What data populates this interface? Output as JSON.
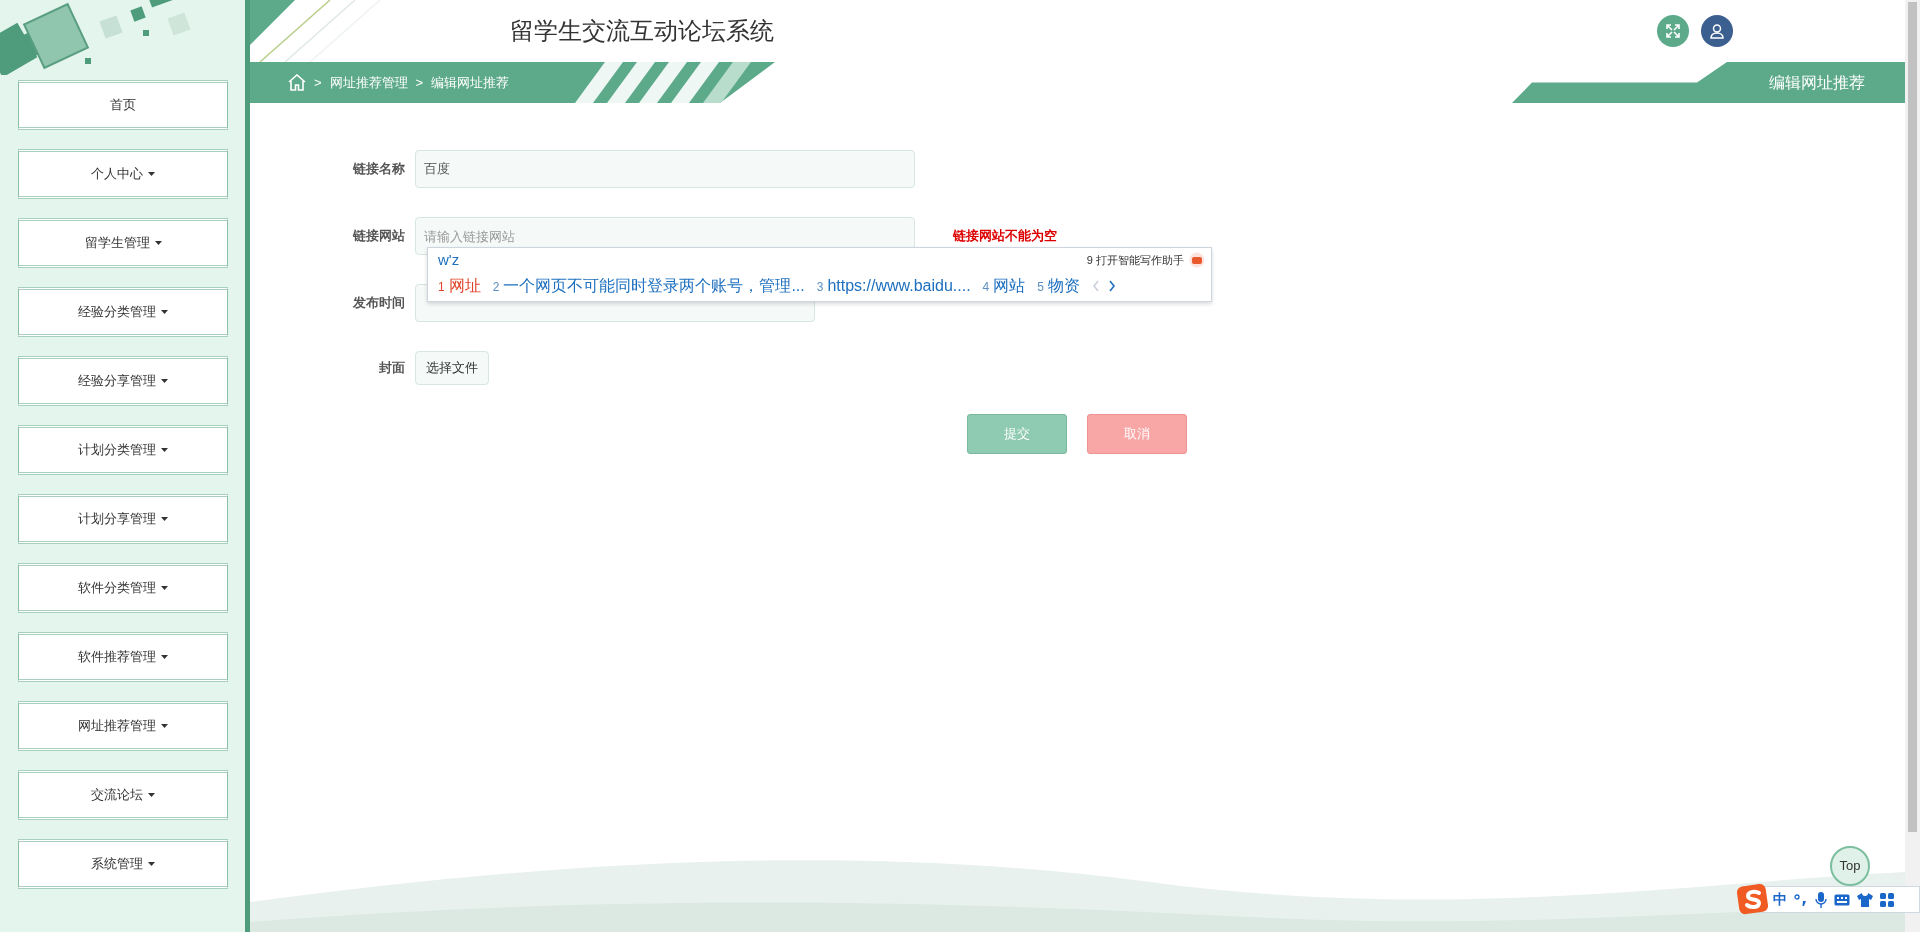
{
  "window": {
    "title": "留学生交流互动论坛系统"
  },
  "sidebar": {
    "items": [
      {
        "label": "首页",
        "dropdown": false
      },
      {
        "label": "个人中心",
        "dropdown": true
      },
      {
        "label": "留学生管理",
        "dropdown": true
      },
      {
        "label": "经验分类管理",
        "dropdown": true
      },
      {
        "label": "经验分享管理",
        "dropdown": true
      },
      {
        "label": "计划分类管理",
        "dropdown": true
      },
      {
        "label": "计划分享管理",
        "dropdown": true
      },
      {
        "label": "软件分类管理",
        "dropdown": true
      },
      {
        "label": "软件推荐管理",
        "dropdown": true
      },
      {
        "label": "网址推荐管理",
        "dropdown": true
      },
      {
        "label": "交流论坛",
        "dropdown": true
      },
      {
        "label": "系统管理",
        "dropdown": true
      }
    ]
  },
  "breadcrumb": [
    {
      "separator": ">",
      "label": "网址推荐管理"
    },
    {
      "separator": ">",
      "label": "编辑网址推荐"
    }
  ],
  "page_title": "编辑网址推荐",
  "form": {
    "fields": [
      {
        "kind": "text",
        "label": "链接名称",
        "value": "百度"
      },
      {
        "kind": "text",
        "label": "链接网站",
        "placeholder": "请输入链接网站",
        "error": "链接网站不能为空"
      },
      {
        "kind": "date",
        "label": "发布时间"
      },
      {
        "kind": "file",
        "label": "封面",
        "button": "选择文件"
      }
    ],
    "buttons": [
      {
        "kind": "submit",
        "label": "提交"
      },
      {
        "kind": "cancel",
        "label": "取消"
      }
    ]
  },
  "ime_popup": {
    "composition": "w'z",
    "assistant": {
      "number": "9",
      "label": "打开智能写作助手"
    },
    "candidates": [
      {
        "number": "1",
        "text": "网址",
        "selected": true
      },
      {
        "number": "2",
        "text": "一个网页不可能同时登录两个账号，管理...",
        "selected": false
      },
      {
        "number": "3",
        "text": "https://www.baidu....",
        "selected": false
      },
      {
        "number": "4",
        "text": "网站",
        "selected": false
      },
      {
        "number": "5",
        "text": "物资",
        "selected": false
      }
    ]
  },
  "back_to_top": "Top",
  "ime_toolbar": {
    "mode": "中"
  }
}
